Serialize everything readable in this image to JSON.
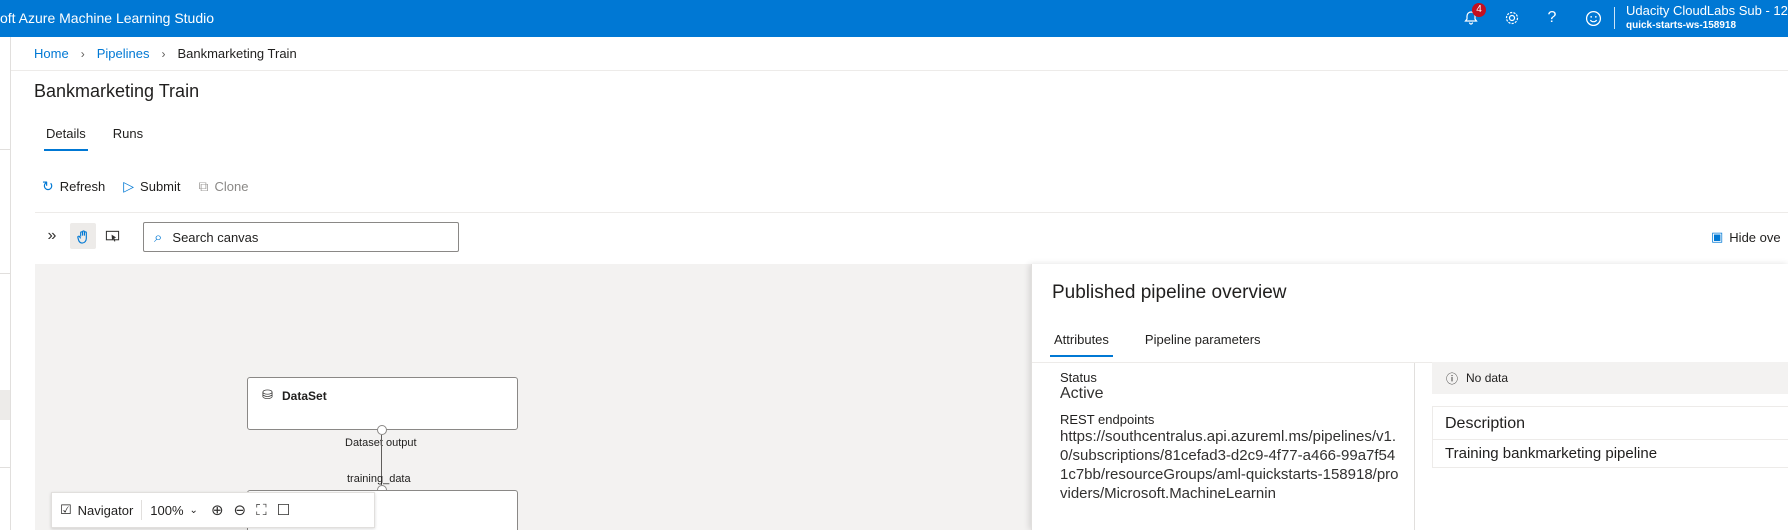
{
  "topbar": {
    "app_title": "oft Azure Machine Learning Studio",
    "notification_count": "4",
    "help_glyph": "?",
    "account_name": "Udacity CloudLabs Sub - 12",
    "workspace": "quick-starts-ws-158918",
    "icons": [
      "bell-icon",
      "gear-icon",
      "help-icon",
      "feedback-smiley-icon"
    ],
    "background_color": "#0078d4"
  },
  "breadcrumb": {
    "items": [
      "Home",
      "Pipelines",
      "Bankmarketing Train"
    ]
  },
  "page": {
    "title": "Bankmarketing Train"
  },
  "tabs": [
    {
      "label": "Details",
      "active": true
    },
    {
      "label": "Runs",
      "active": false
    }
  ],
  "actions": {
    "refresh": "Refresh",
    "submit": "Submit",
    "clone": "Clone"
  },
  "canvas_toolbar": {
    "search_placeholder": "Search canvas",
    "hide_overview": "Hide ove",
    "icons": [
      "expand-chevrons-icon",
      "pan-hand-icon",
      "select-pointer-icon",
      "search-icon"
    ]
  },
  "canvas": {
    "nodes": [
      {
        "label": "DataSet",
        "icon": "dataset-cylinder-icon"
      },
      {
        "label": "",
        "icon": ""
      }
    ],
    "ports": {
      "output": "Dataset output",
      "input": "training_data"
    },
    "navigator": {
      "label": "Navigator",
      "zoom": "100%",
      "icons": [
        "navigator-checkbox-icon",
        "zoom-in-icon",
        "zoom-out-icon",
        "fit-screen-icon",
        "actual-size-icon"
      ]
    }
  },
  "overview": {
    "title": "Published pipeline overview",
    "tabs": [
      {
        "label": "Attributes",
        "active": true
      },
      {
        "label": "Pipeline parameters",
        "active": false
      }
    ],
    "status_label": "Status",
    "status_value": "Active",
    "rest_label": "REST endpoints",
    "rest_value": "https://southcentralus.api.azureml.ms/pipelines/v1.0/subscriptions/81cefad3-d2c9-4f77-a466-99a7f541c7bb/resourceGroups/aml-quickstarts-158918/providers/Microsoft.MachineLearnin",
    "no_data": "No data",
    "description_label": "Description",
    "description_value": "Training bankmarketing pipeline"
  }
}
